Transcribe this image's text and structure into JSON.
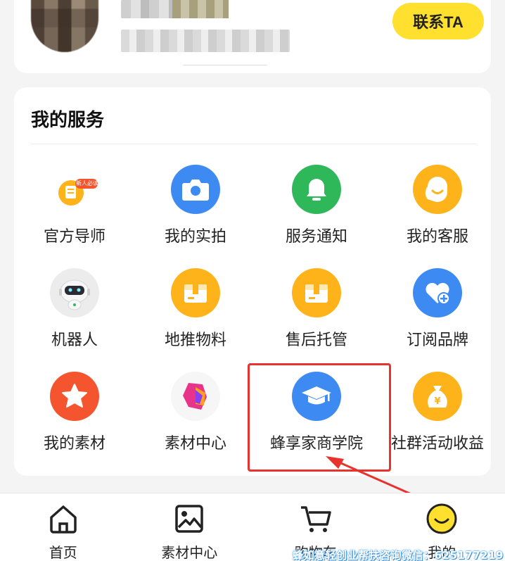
{
  "profile": {
    "contact_label": "联系TA"
  },
  "services": {
    "title": "我的服务",
    "items": [
      {
        "label": "官方导师",
        "icon": "mentor-icon",
        "color": "#ffb31a",
        "badge": "新人必读"
      },
      {
        "label": "我的实拍",
        "icon": "camera-icon",
        "color": "#3d8bf2"
      },
      {
        "label": "服务通知",
        "icon": "bell-icon",
        "color": "#2fb85a"
      },
      {
        "label": "我的客服",
        "icon": "customer-service-icon",
        "color": "#ffb31a"
      },
      {
        "label": "机器人",
        "icon": "robot-icon",
        "color": "#eeeeee"
      },
      {
        "label": "地推物料",
        "icon": "box-icon",
        "color": "#ffb31a"
      },
      {
        "label": "售后托管",
        "icon": "box-icon",
        "color": "#ffb31a"
      },
      {
        "label": "订阅品牌",
        "icon": "heart-plus-icon",
        "color": "#3d8bf2"
      },
      {
        "label": "我的素材",
        "icon": "star-icon",
        "color": "#f4552e"
      },
      {
        "label": "素材中心",
        "icon": "material-center-icon",
        "color": "#f7f7f7"
      },
      {
        "label": "蜂享家商学院",
        "icon": "graduation-cap-icon",
        "color": "#3d8bf2"
      },
      {
        "label": "社群活动收益",
        "icon": "money-bag-icon",
        "color": "#ffb31a"
      }
    ]
  },
  "bottom_nav": {
    "items": [
      {
        "label": "首页",
        "icon": "home-icon"
      },
      {
        "label": "素材中心",
        "icon": "image-icon"
      },
      {
        "label": "购物车",
        "icon": "cart-icon"
      },
      {
        "label": "我的",
        "icon": "smile-icon",
        "active_color": "#ffe02e"
      }
    ]
  },
  "watermark": "蜂如意轻创业帮扶咨询微信：625177219"
}
